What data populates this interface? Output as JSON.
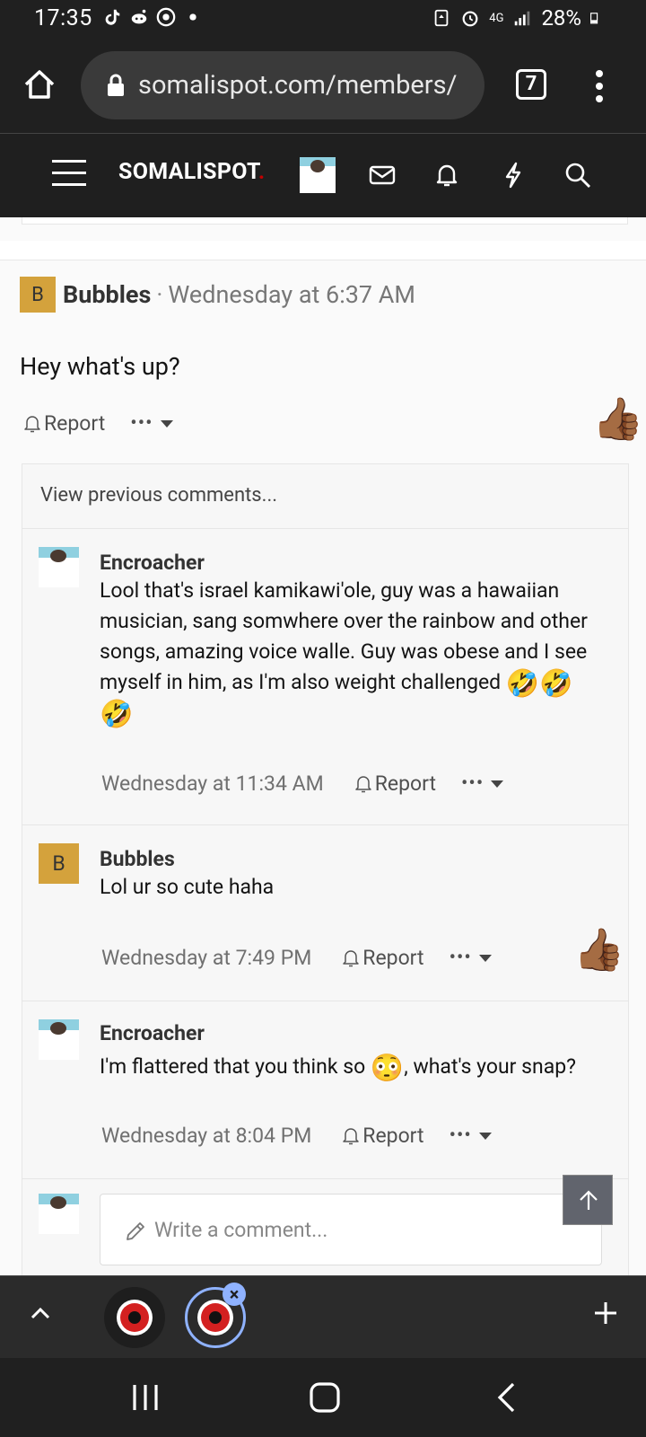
{
  "status_bar": {
    "time": "17:35",
    "network": "4G",
    "battery": "28%"
  },
  "browser": {
    "url": "somalispot.com/members/",
    "tab_count": "7"
  },
  "site": {
    "logo_text": "SOMALISPOT",
    "logo_dot": "."
  },
  "post": {
    "author_initial": "B",
    "author": "Bubbles",
    "separator": "·",
    "date": "Wednesday at 6:37 AM",
    "text": "Hey what's up?",
    "report_label": "Report",
    "more_label": "•••",
    "reaction": "👍🏾"
  },
  "comments": {
    "view_previous": "View previous comments...",
    "items": [
      {
        "author": "Encroacher",
        "text": "Lool that's israel kamikawi'ole, guy was a hawaiian musician, sang somwhere over the rainbow and other songs, amazing voice walle. Guy was obese and I see myself in him, as I'm also weight challenged",
        "emoji": "🤣🤣🤣",
        "date": "Wednesday at 11:34 AM",
        "report_label": "Report",
        "more_label": "•••"
      },
      {
        "author_initial": "B",
        "author": "Bubbles",
        "text": "Lol ur so cute haha",
        "date": "Wednesday at 7:49 PM",
        "report_label": "Report",
        "more_label": "•••",
        "reaction": "👍🏾"
      },
      {
        "author": "Encroacher",
        "text_before": "I'm flattered that you think so ",
        "emoji": "😳",
        "text_after": ", what's your snap?",
        "date": "Wednesday at 8:04 PM",
        "report_label": "Report",
        "more_label": "•••"
      }
    ],
    "write_placeholder": "Write a comment..."
  },
  "tab_switcher": {
    "close_label": "×"
  }
}
